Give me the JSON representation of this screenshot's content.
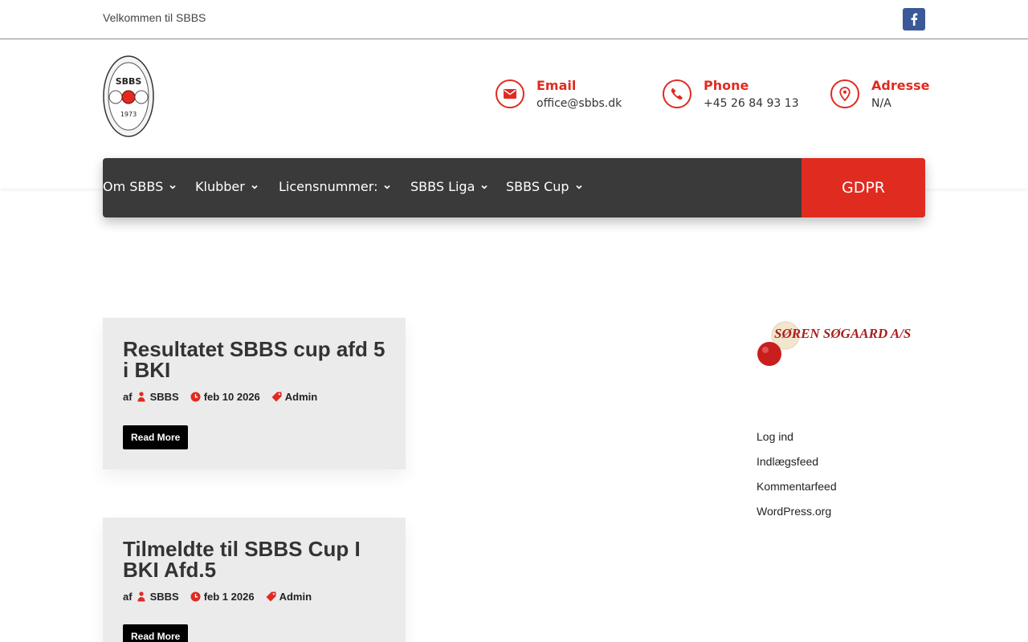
{
  "topbar": {
    "welcome": "Velkommen til SBBS",
    "social_icon": "facebook-icon"
  },
  "header": {
    "logo": {
      "top_text": "SBBS",
      "year": "1973"
    },
    "contacts": [
      {
        "icon": "envelope-icon",
        "title": "Email",
        "value": "office@sbbs.dk"
      },
      {
        "icon": "phone-icon",
        "title": "Phone",
        "value": "+45 26 84 93 13"
      },
      {
        "icon": "map-pin-icon",
        "title": "Adresse",
        "value": "N/A"
      }
    ]
  },
  "nav": {
    "items": [
      "Om SBBS",
      "Klubber",
      "Licensnummer:",
      "SBBS Liga",
      "SBBS Cup"
    ],
    "cta": "GDPR"
  },
  "posts": [
    {
      "title": "Resultatet SBBS cup afd 5 i BKI",
      "by_label": "af",
      "author": "SBBS",
      "date": "feb 10 2026",
      "category": "Admin",
      "read_more": "Read More"
    },
    {
      "title": "Tilmeldte til SBBS Cup I BKI Afd.5",
      "by_label": "af",
      "author": "SBBS",
      "date": "feb 1 2026",
      "category": "Admin",
      "read_more": "Read More"
    }
  ],
  "sidebar": {
    "sponsor": "SØREN SØGAARD A/S",
    "links": [
      "Log ind",
      "Indlægsfeed",
      "Kommentarfeed",
      "WordPress.org"
    ]
  },
  "colors": {
    "accent": "#e02b20",
    "nav_bg": "#3a3a3a",
    "card_bg": "#ebebeb",
    "facebook": "#3b5998"
  }
}
